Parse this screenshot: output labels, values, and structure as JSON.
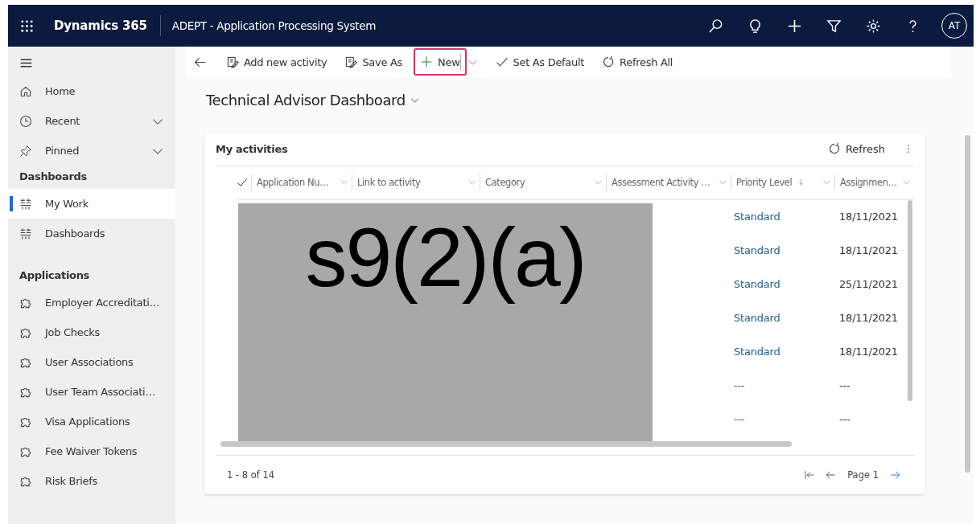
{
  "header": {
    "brand": "Dynamics 365",
    "app_title": "ADEPT - Application Processing System",
    "avatar": "AT"
  },
  "command_bar": [
    {
      "kind": "back"
    },
    {
      "kind": "edit",
      "label": "Add new activity",
      "highlighted": false
    },
    {
      "kind": "edit",
      "label": "Save As",
      "highlighted": false
    },
    {
      "kind": "new",
      "label": "New",
      "highlighted": true
    },
    {
      "kind": "check",
      "label": "Set As Default",
      "highlighted": false
    },
    {
      "kind": "refresh",
      "label": "Refresh All",
      "highlighted": false
    }
  ],
  "dashboard_title": "Technical Advisor Dashboard",
  "sidebar": {
    "items": [
      {
        "kind": "home",
        "label": "Home",
        "expandable": false,
        "selected": false
      },
      {
        "kind": "recent",
        "label": "Recent",
        "expandable": true,
        "selected": false
      },
      {
        "kind": "pinned",
        "label": "Pinned",
        "expandable": true,
        "selected": false
      }
    ],
    "sections": [
      {
        "title": "Dashboards",
        "items": [
          {
            "kind": "dashboard",
            "label": "My Work",
            "selected": true
          },
          {
            "kind": "dashboard",
            "label": "Dashboards",
            "selected": false
          }
        ]
      },
      {
        "title": "Applications",
        "items": [
          {
            "kind": "entity",
            "label": "Employer Accreditati…",
            "selected": false
          },
          {
            "kind": "entity",
            "label": "Job Checks",
            "selected": false
          },
          {
            "kind": "entity",
            "label": "User Associations",
            "selected": false
          },
          {
            "kind": "entity",
            "label": "User Team Associati…",
            "selected": false
          },
          {
            "kind": "entity",
            "label": "Visa Applications",
            "selected": false
          },
          {
            "kind": "entity",
            "label": "Fee Waiver Tokens",
            "selected": false
          },
          {
            "kind": "entity",
            "label": "Risk Briefs",
            "selected": false
          }
        ]
      }
    ]
  },
  "card": {
    "title": "My activities",
    "refresh": "Refresh",
    "columns": [
      {
        "label": "Application Nu…",
        "sorted": false
      },
      {
        "label": "Link to activity",
        "sorted": false
      },
      {
        "label": "Category",
        "sorted": false
      },
      {
        "label": "Assessment Activity …",
        "sorted": false
      },
      {
        "label": "Priority Level",
        "sorted": true
      },
      {
        "label": "Assignmen…",
        "sorted": false
      }
    ],
    "rows": [
      {
        "priority_level": "Standard",
        "assignment": "18/11/2021"
      },
      {
        "priority_level": "Standard",
        "assignment": "18/11/2021"
      },
      {
        "priority_level": "Standard",
        "assignment": "25/11/2021"
      },
      {
        "priority_level": "Standard",
        "assignment": "18/11/2021"
      },
      {
        "priority_level": "Standard",
        "assignment": "18/11/2021"
      },
      {
        "priority_level": "---",
        "assignment": "---"
      },
      {
        "priority_level": "---",
        "assignment": "---"
      }
    ],
    "redaction": "s9(2)(a)",
    "record_count": "1 - 8 of 14",
    "page": "Page 1"
  }
}
